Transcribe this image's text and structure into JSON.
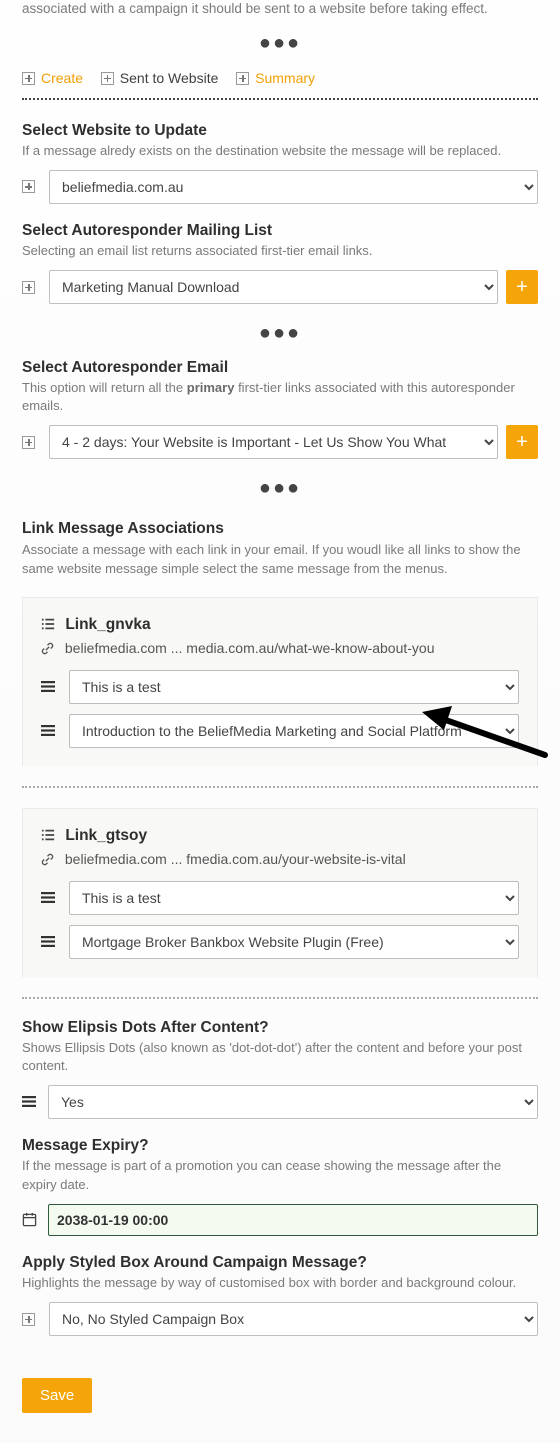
{
  "top_fragment": "associated with a campaign it should be sent to a website before taking effect.",
  "tabs": {
    "create": "Create",
    "sent": "Sent to Website",
    "summary": "Summary"
  },
  "website": {
    "title": "Select Website to Update",
    "desc": "If a message alredy exists on the destination website the message will be replaced.",
    "value": "beliefmedia.com.au"
  },
  "mailing": {
    "title": "Select Autoresponder Mailing List",
    "desc": "Selecting an email list returns associated first-tier email links.",
    "value": "Marketing Manual Download"
  },
  "email": {
    "title": "Select Autoresponder Email",
    "desc_pre": "This option will return all the ",
    "desc_bold": "primary",
    "desc_post": " first-tier links associated with this autoresponder emails.",
    "value": "4 - 2 days: Your Website is Important - Let Us Show You What"
  },
  "assoc": {
    "title": "Link Message Associations",
    "desc": "Associate a message with each link in your email. If you woudl like all links to show the same website message simple select the same message from the menus."
  },
  "links": [
    {
      "name": "Link_gnvka",
      "url": "beliefmedia.com ... media.com.au/what-we-know-about-you",
      "sel1": "This is a test",
      "sel2": "Introduction to the BeliefMedia Marketing and Social Platform"
    },
    {
      "name": "Link_gtsoy",
      "url": "beliefmedia.com ... fmedia.com.au/your-website-is-vital",
      "sel1": "This is a test",
      "sel2": "Mortgage Broker Bankbox Website Plugin (Free)"
    }
  ],
  "ellipsis": {
    "title": "Show Elipsis Dots After Content?",
    "desc": "Shows Ellipsis Dots (also known as 'dot-dot-dot') after the content and before your post content.",
    "value": "Yes"
  },
  "expiry": {
    "title": "Message Expiry?",
    "desc": "If the message is part of a promotion you can cease showing the message after the expiry date.",
    "value": "2038-01-19 00:00"
  },
  "styled": {
    "title": "Apply Styled Box Around Campaign Message?",
    "desc": "Highlights the message by way of customised box with border and background colour.",
    "value": "No, No Styled Campaign Box"
  },
  "save": "Save"
}
